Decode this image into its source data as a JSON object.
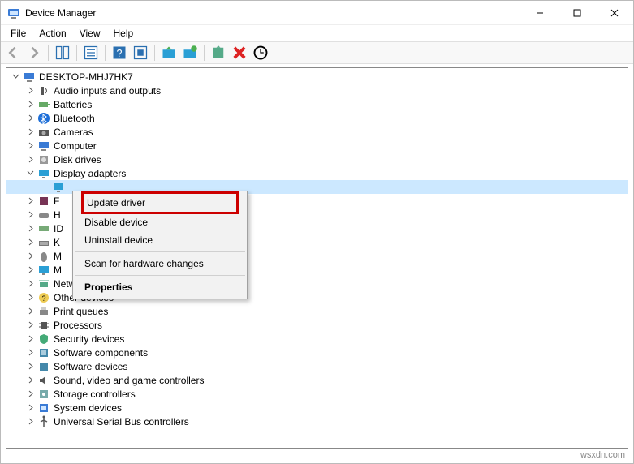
{
  "window": {
    "title": "Device Manager",
    "menus": [
      "File",
      "Action",
      "View",
      "Help"
    ]
  },
  "toolbar": {
    "buttons": [
      "back",
      "forward",
      "show-hidden",
      "properties-sheet",
      "help",
      "uninstall",
      "scan",
      "update",
      "add-legacy",
      "remove",
      "scan-hardware"
    ]
  },
  "tree": {
    "root": "DESKTOP-MHJ7HK7",
    "nodes": [
      {
        "label": "Audio inputs and outputs",
        "icon": "audio"
      },
      {
        "label": "Batteries",
        "icon": "battery"
      },
      {
        "label": "Bluetooth",
        "icon": "bluetooth"
      },
      {
        "label": "Cameras",
        "icon": "camera"
      },
      {
        "label": "Computer",
        "icon": "computer"
      },
      {
        "label": "Disk drives",
        "icon": "disk"
      },
      {
        "label": "Display adapters",
        "icon": "display",
        "expanded": true,
        "children": [
          {
            "label": "",
            "icon": "display",
            "selected": true
          }
        ]
      },
      {
        "label": "F",
        "icon": "firmware"
      },
      {
        "label": "H",
        "icon": "hid"
      },
      {
        "label": "ID",
        "icon": "ide"
      },
      {
        "label": "K",
        "icon": "keyboard"
      },
      {
        "label": "M",
        "icon": "mouse"
      },
      {
        "label": "M",
        "icon": "monitor"
      },
      {
        "label": "Network adapters",
        "icon": "network"
      },
      {
        "label": "Other devices",
        "icon": "other"
      },
      {
        "label": "Print queues",
        "icon": "printer"
      },
      {
        "label": "Processors",
        "icon": "cpu"
      },
      {
        "label": "Security devices",
        "icon": "security"
      },
      {
        "label": "Software components",
        "icon": "swcomp"
      },
      {
        "label": "Software devices",
        "icon": "swdev"
      },
      {
        "label": "Sound, video and game controllers",
        "icon": "sound"
      },
      {
        "label": "Storage controllers",
        "icon": "storage"
      },
      {
        "label": "System devices",
        "icon": "system"
      },
      {
        "label": "Universal Serial Bus controllers",
        "icon": "usb"
      }
    ]
  },
  "context_menu": {
    "items": [
      {
        "label": "Update driver",
        "highlight": true
      },
      {
        "label": "Disable device"
      },
      {
        "label": "Uninstall device"
      },
      {
        "sep": true
      },
      {
        "label": "Scan for hardware changes"
      },
      {
        "sep": true
      },
      {
        "label": "Properties",
        "bold": true
      }
    ]
  },
  "watermark": "wsxdn.com"
}
